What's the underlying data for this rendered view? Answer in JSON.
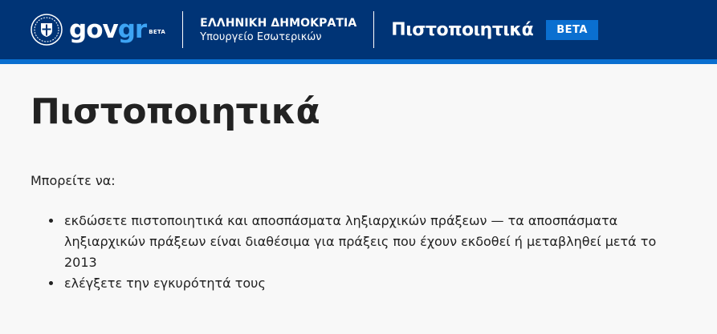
{
  "header": {
    "logo": {
      "word_gov": "gov",
      "word_gr": "gr",
      "beta": "BETA"
    },
    "ministry": {
      "title": "ΕΛΛΗΝΙΚΗ ΔΗΜΟΚΡΑΤΙΑ",
      "subtitle": "Υπουργείο Εσωτερικών"
    },
    "service_title": "Πιστοποιητικά",
    "beta_badge": "BETA",
    "colors": {
      "background": "#003476",
      "accent": "#0a6fd0",
      "logo_gr": "#3da4f4"
    },
    "emblem_icon": "greek-emblem-icon"
  },
  "main": {
    "title": "Πιστοποιητικά",
    "intro": "Μπορείτε να:",
    "items": [
      "εκδώσετε πιστοποιητικά και αποσπάσματα ληξιαρχικών πράξεων — τα αποσπάσματα ληξιαρχικών πράξεων είναι διαθέσιμα για πράξεις που έχουν εκδοθεί ή μεταβληθεί μετά το 2013",
      "ελέγξετε την εγκυρότητά τους"
    ]
  }
}
